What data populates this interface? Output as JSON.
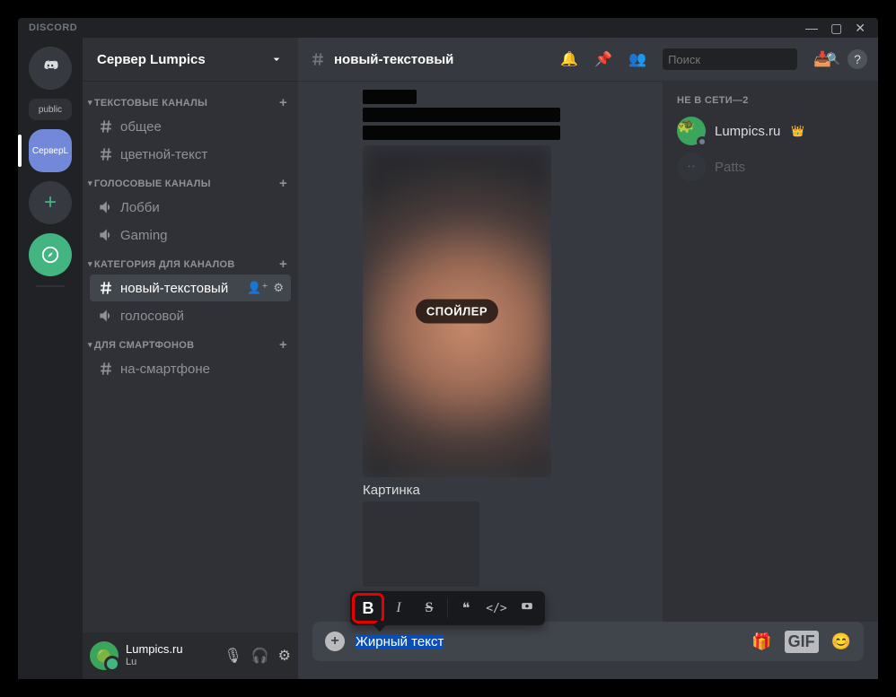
{
  "titlebar": {
    "logo": "DISCORD"
  },
  "rail": {
    "home_label": "Home",
    "folder_label": "public",
    "selected_server": "СерверL",
    "add_label": "+",
    "explore": "✦"
  },
  "server": {
    "name": "Сервер Lumpics"
  },
  "categories": [
    {
      "name": "ТЕКСТОВЫЕ КАНАЛЫ",
      "channels": [
        {
          "name": "общее",
          "type": "text",
          "active": false
        },
        {
          "name": "цветной-текст",
          "type": "text",
          "active": false
        }
      ]
    },
    {
      "name": "ГОЛОСОВЫЕ КАНАЛЫ",
      "channels": [
        {
          "name": "Лобби",
          "type": "voice",
          "active": false
        },
        {
          "name": "Gaming",
          "type": "voice",
          "active": false
        }
      ]
    },
    {
      "name": "КАТЕГОРИЯ ДЛЯ КАНАЛОВ",
      "channels": [
        {
          "name": "новый-текстовый",
          "type": "text",
          "active": true
        },
        {
          "name": "голосовой",
          "type": "voice",
          "active": false
        }
      ]
    },
    {
      "name": "ДЛЯ СМАРТФОНОВ",
      "channels": [
        {
          "name": "на-смартфоне",
          "type": "text",
          "active": false
        }
      ]
    }
  ],
  "user_panel": {
    "name": "Lumpics.ru",
    "tag": "Lu"
  },
  "chat": {
    "channel_title": "новый-текстовый",
    "spoiler_badge": "СПОЙЛЕР",
    "caption": "Картинка",
    "search_placeholder": "Поиск"
  },
  "members": {
    "heading": "НЕ В СЕТИ—2",
    "items": [
      {
        "name": "Lumpics.ru",
        "owner": true
      },
      {
        "name": "Patts",
        "owner": false
      }
    ]
  },
  "toolbar": {
    "bold": "B",
    "italic": "I",
    "strike": "S",
    "quote": "❝",
    "code": "</>",
    "spoiler": "👁"
  },
  "composer": {
    "text": "Жирный текст",
    "gif": "GIF"
  }
}
